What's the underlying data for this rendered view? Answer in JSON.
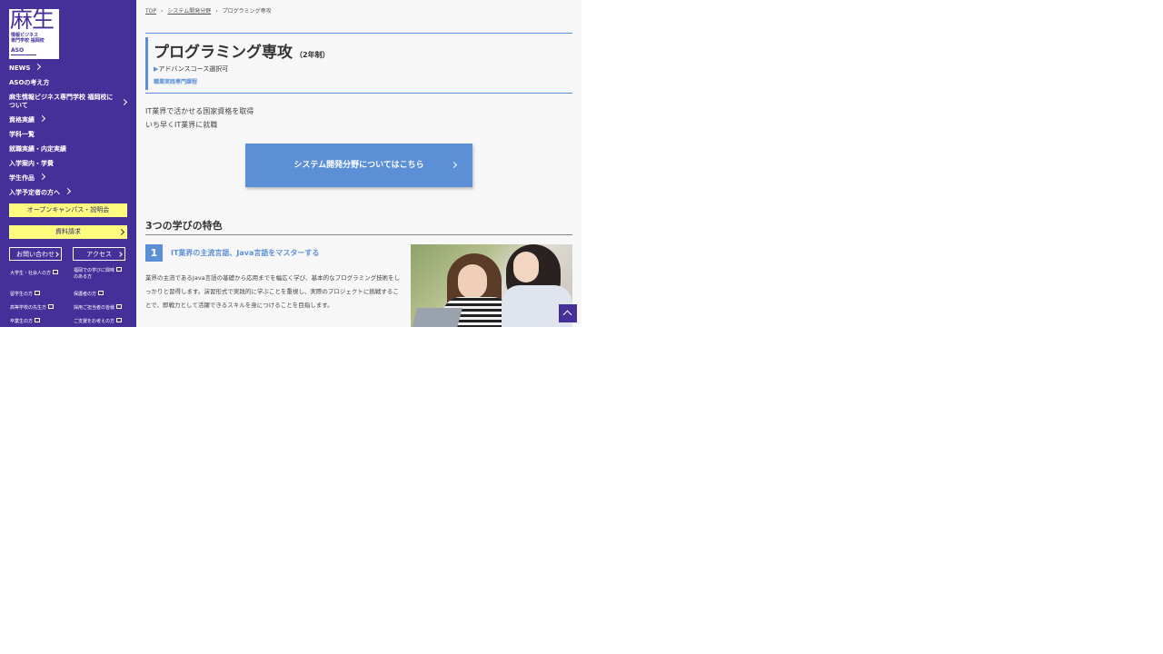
{
  "logo": {
    "big": "麻生",
    "line1": "情報ビジネス",
    "line2": "専門学校 福岡校",
    "aso": "ASO"
  },
  "sidebar": {
    "nav": [
      {
        "label": "NEWS"
      },
      {
        "label": "ASOの考え方"
      },
      {
        "label": "麻生情報ビジネス専門学校 福岡校に",
        "label2": "ついて"
      },
      {
        "label": "資格実績"
      },
      {
        "label": "学科一覧"
      },
      {
        "label": "就職実績・内定実績"
      },
      {
        "label": "入学案内・学費"
      },
      {
        "label": "学生作品"
      },
      {
        "label": "入学予定者の方へ"
      }
    ],
    "open_campus": "オープンキャンパス・説明会",
    "brochure": "資料請求",
    "contact": "お問い合わせ",
    "access": "アクセス",
    "small_links": [
      "大学生・社会人の方",
      "福岡での学びに興味",
      "のある方",
      "留学生の方",
      "保護者の方",
      "高等学校の先生方",
      "採用ご担当者の皆様",
      "卒業生の方",
      "ご支援をお考えの方"
    ]
  },
  "breadcrumb": {
    "top": "TOP",
    "field": "システム開発分野",
    "current": "プログラミング専攻"
  },
  "header": {
    "title": "プログラミング専攻",
    "years": "（2年制）",
    "advance_marker": "▶",
    "advance": "アドバンスコース選択可",
    "vocational": "職業実践専門課程"
  },
  "description": {
    "line1": "IT業界で活かせる国家資格を取得",
    "line2": "いち早くIT業界に就職"
  },
  "cta": {
    "label": "システム開発分野についてはこちら"
  },
  "features": {
    "title": "3つの学びの特色",
    "items": [
      {
        "num": "1",
        "title": "IT業界の主流言語、Java言語をマスターする",
        "text": "業界の主流であるJava言語の基礎から応用までを幅広く学び、基本的なプログラミング技術をしっかりと習得します。演習形式で実践的に学ぶことを重視し、実際のプロジェクトに挑戦することで、即戦力として活躍できるスキルを身につけることを目指します。"
      }
    ]
  }
}
